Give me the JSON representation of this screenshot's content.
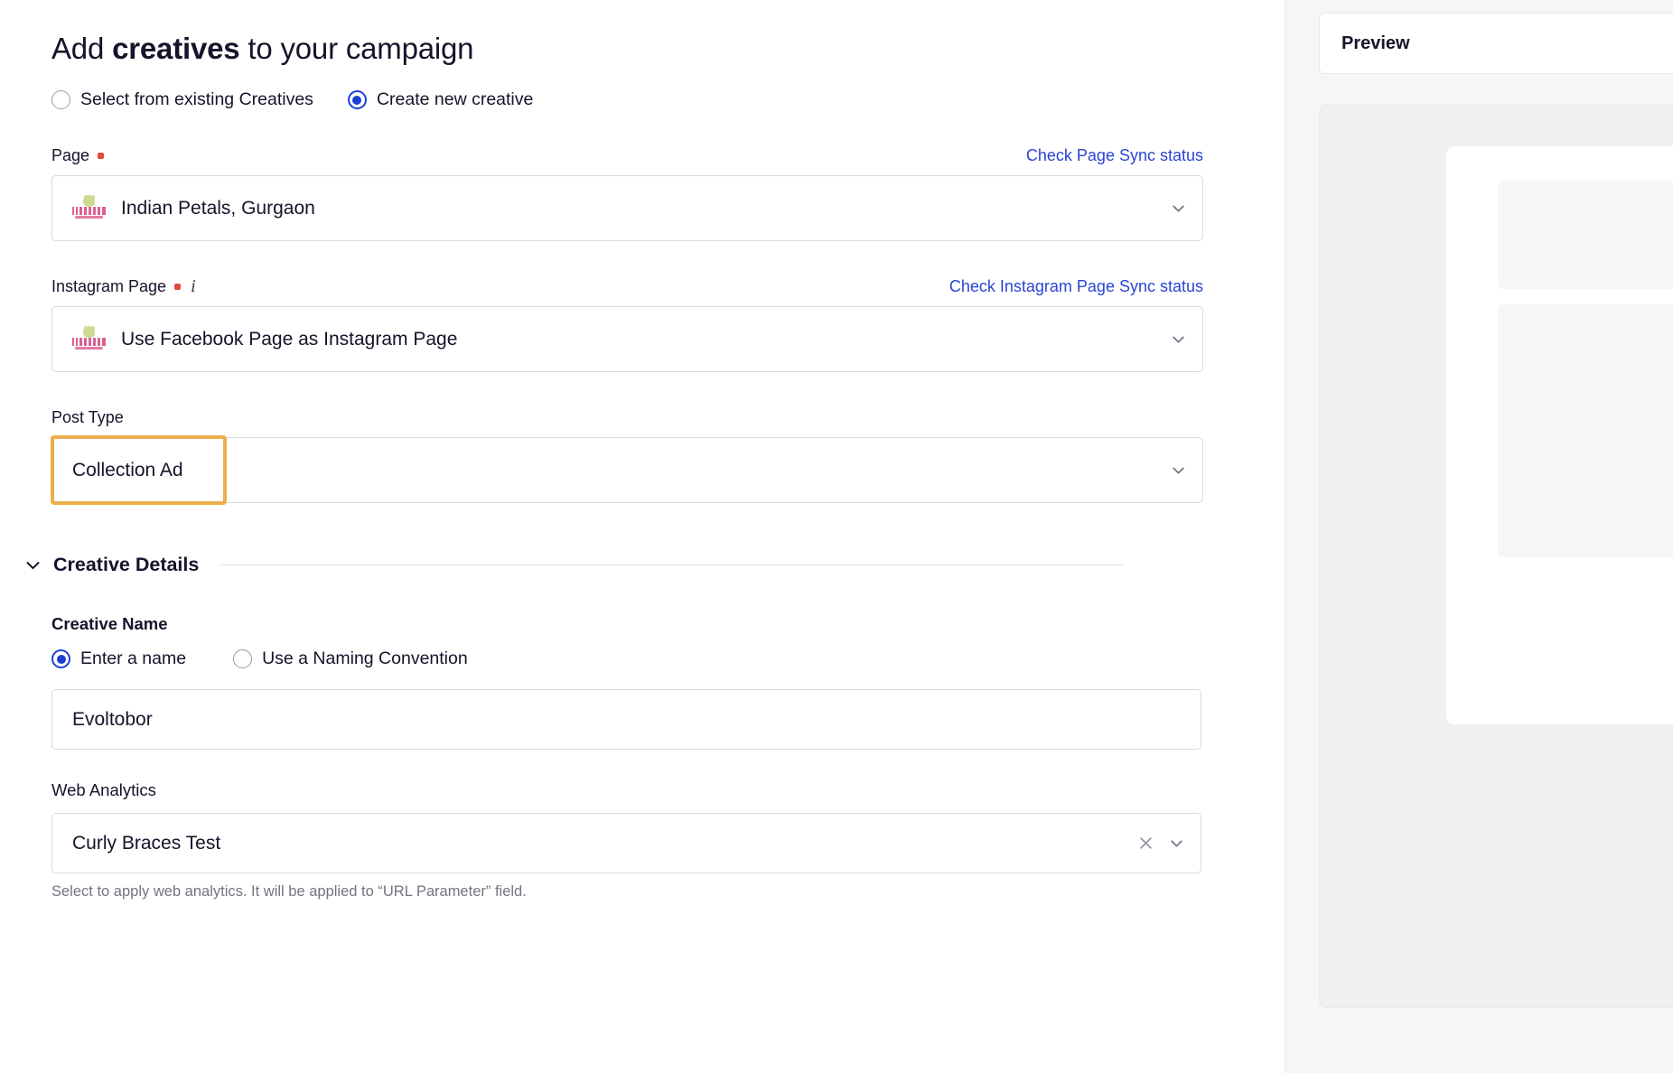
{
  "header": {
    "title_prefix": "Add ",
    "title_bold": "creatives",
    "title_suffix": " to your campaign"
  },
  "source_radios": [
    {
      "label": "Select from existing Creatives",
      "selected": false
    },
    {
      "label": "Create new creative",
      "selected": true
    }
  ],
  "page_field": {
    "label": "Page",
    "required": true,
    "link": "Check Page Sync status",
    "value": "Indian Petals, Gurgaon",
    "logo_icon": "indian-petals-logo",
    "chevron_icon": "chevron-down-icon"
  },
  "instagram_field": {
    "label": "Instagram Page",
    "required": true,
    "info_icon": "info-icon",
    "link": "Check Instagram Page Sync status",
    "value": "Use Facebook Page as Instagram Page",
    "logo_icon": "indian-petals-logo",
    "chevron_icon": "chevron-down-icon"
  },
  "post_type_field": {
    "label": "Post Type",
    "value": "Collection Ad",
    "highlight_color": "#edae4d",
    "chevron_icon": "chevron-down-icon"
  },
  "creative_details": {
    "title": "Creative Details",
    "chevron_icon": "chevron-down-icon",
    "creative_name": {
      "label": "Creative Name",
      "radios": [
        {
          "label": "Enter a name",
          "selected": true
        },
        {
          "label": "Use a Naming Convention",
          "selected": false
        }
      ],
      "value": "Evoltobor",
      "placeholder": "Enter a name"
    },
    "web_analytics": {
      "label": "Web Analytics",
      "value": "Curly Braces Test",
      "clear_icon": "close-icon",
      "chevron_icon": "chevron-down-icon",
      "helper": "Select to apply web analytics. It will be applied to “URL Parameter” field."
    }
  },
  "preview": {
    "title": "Preview"
  },
  "colors": {
    "accent_blue": "#1d3fd6",
    "link_blue": "#2b45d4",
    "required_red": "#e2483d",
    "highlight_orange": "#edae4d",
    "text_dark": "#14142b",
    "muted": "#72757f",
    "border": "#d7d9e0"
  }
}
